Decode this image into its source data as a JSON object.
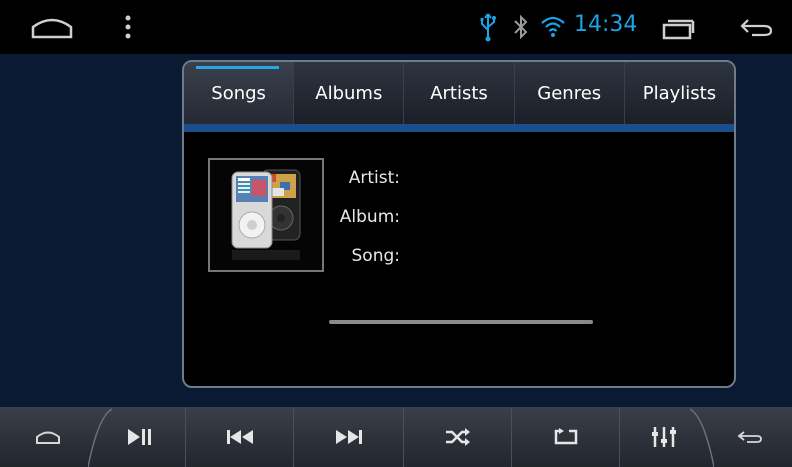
{
  "status_bar": {
    "time": "14:34",
    "icons": [
      "home-outline-icon",
      "menu-dots-icon",
      "usb-icon",
      "bluetooth-icon",
      "wifi-icon",
      "recent-apps-icon",
      "back-icon"
    ],
    "accent_color": "#1ca3e6"
  },
  "tabs": [
    {
      "label": "Songs",
      "active": true
    },
    {
      "label": "Albums",
      "active": false
    },
    {
      "label": "Artists",
      "active": false
    },
    {
      "label": "Genres",
      "active": false
    },
    {
      "label": "Playlists",
      "active": false
    }
  ],
  "now_playing": {
    "artist_label": "Artist:",
    "album_label": "Album:",
    "song_label": "Song:"
  },
  "controls": {
    "icons": [
      "home-icon",
      "play-pause-icon",
      "previous-icon",
      "next-icon",
      "shuffle-icon",
      "repeat-icon",
      "equalizer-icon",
      "back-icon"
    ]
  },
  "colors": {
    "background": "#0b1a33",
    "tab_highlight": "#2aa6e8",
    "tab_underline": "#1b4e8c"
  }
}
